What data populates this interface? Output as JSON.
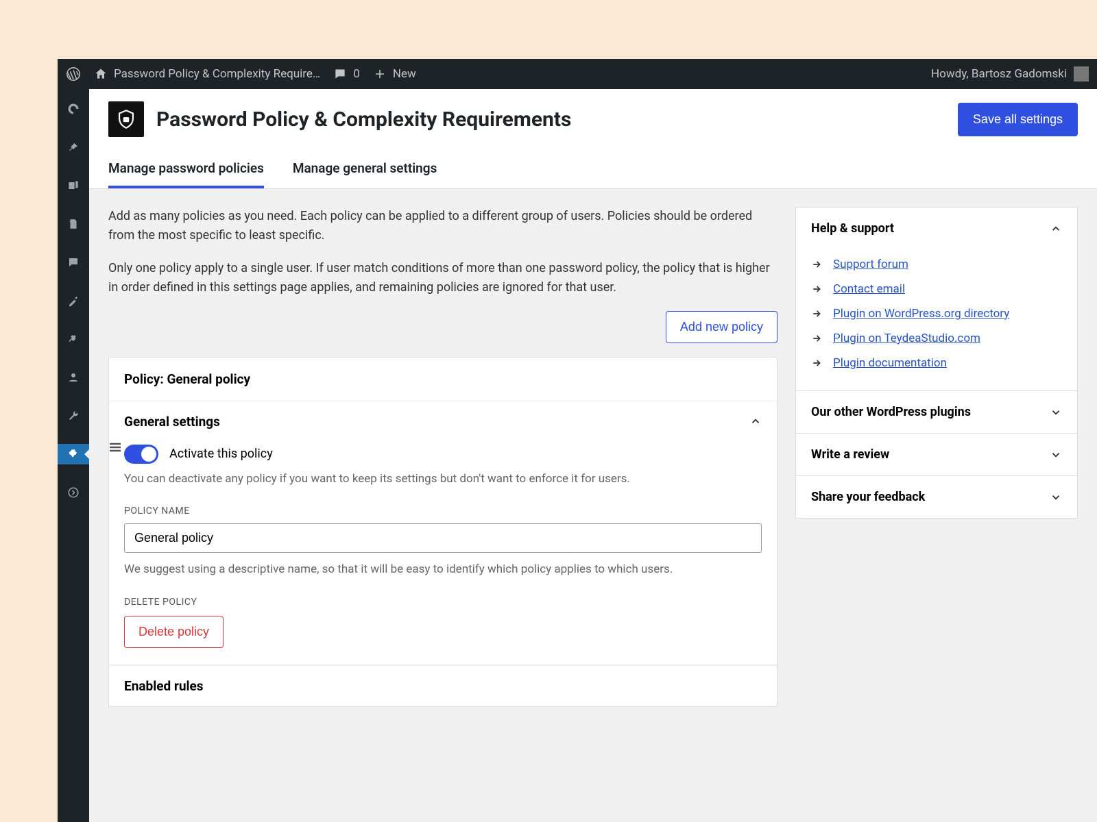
{
  "adminbar": {
    "site_name": "Password Policy & Complexity Require…",
    "comment_count": "0",
    "new_label": "New",
    "greeting": "Howdy, Bartosz Gadomski"
  },
  "page": {
    "title": "Password Policy & Complexity Requirements",
    "save_button": "Save all settings",
    "tabs": {
      "policies": "Manage password policies",
      "general": "Manage general settings"
    },
    "intro_p1": "Add as many policies as you need. Each policy can be applied to a different group of users. Policies should be ordered from the most specific to least specific.",
    "intro_p2": "Only one policy apply to a single user. If user match conditions of more than one password policy, the policy that is higher in order defined in this settings page applies, and remaining policies are ignored for that user.",
    "add_policy": "Add new policy"
  },
  "policy": {
    "card_title": "Policy: General policy",
    "general_settings": "General settings",
    "activate_label": "Activate this policy",
    "activate_desc": "You can deactivate any policy if you want to keep its settings but don't want to enforce it for users.",
    "policy_name_label": "POLICY NAME",
    "policy_name_value": "General policy",
    "policy_name_help": "We suggest using a descriptive name, so that it will be easy to identify which policy applies to which users.",
    "delete_label": "DELETE POLICY",
    "delete_button": "Delete policy",
    "enabled_rules": "Enabled rules"
  },
  "sidebar": {
    "help_title": "Help & support",
    "links": [
      "Support forum",
      "Contact email",
      "Plugin on WordPress.org directory",
      "Plugin on TeydeaStudio.com",
      "Plugin documentation"
    ],
    "other_plugins": "Our other WordPress plugins",
    "review": "Write a review",
    "feedback": "Share your feedback"
  }
}
